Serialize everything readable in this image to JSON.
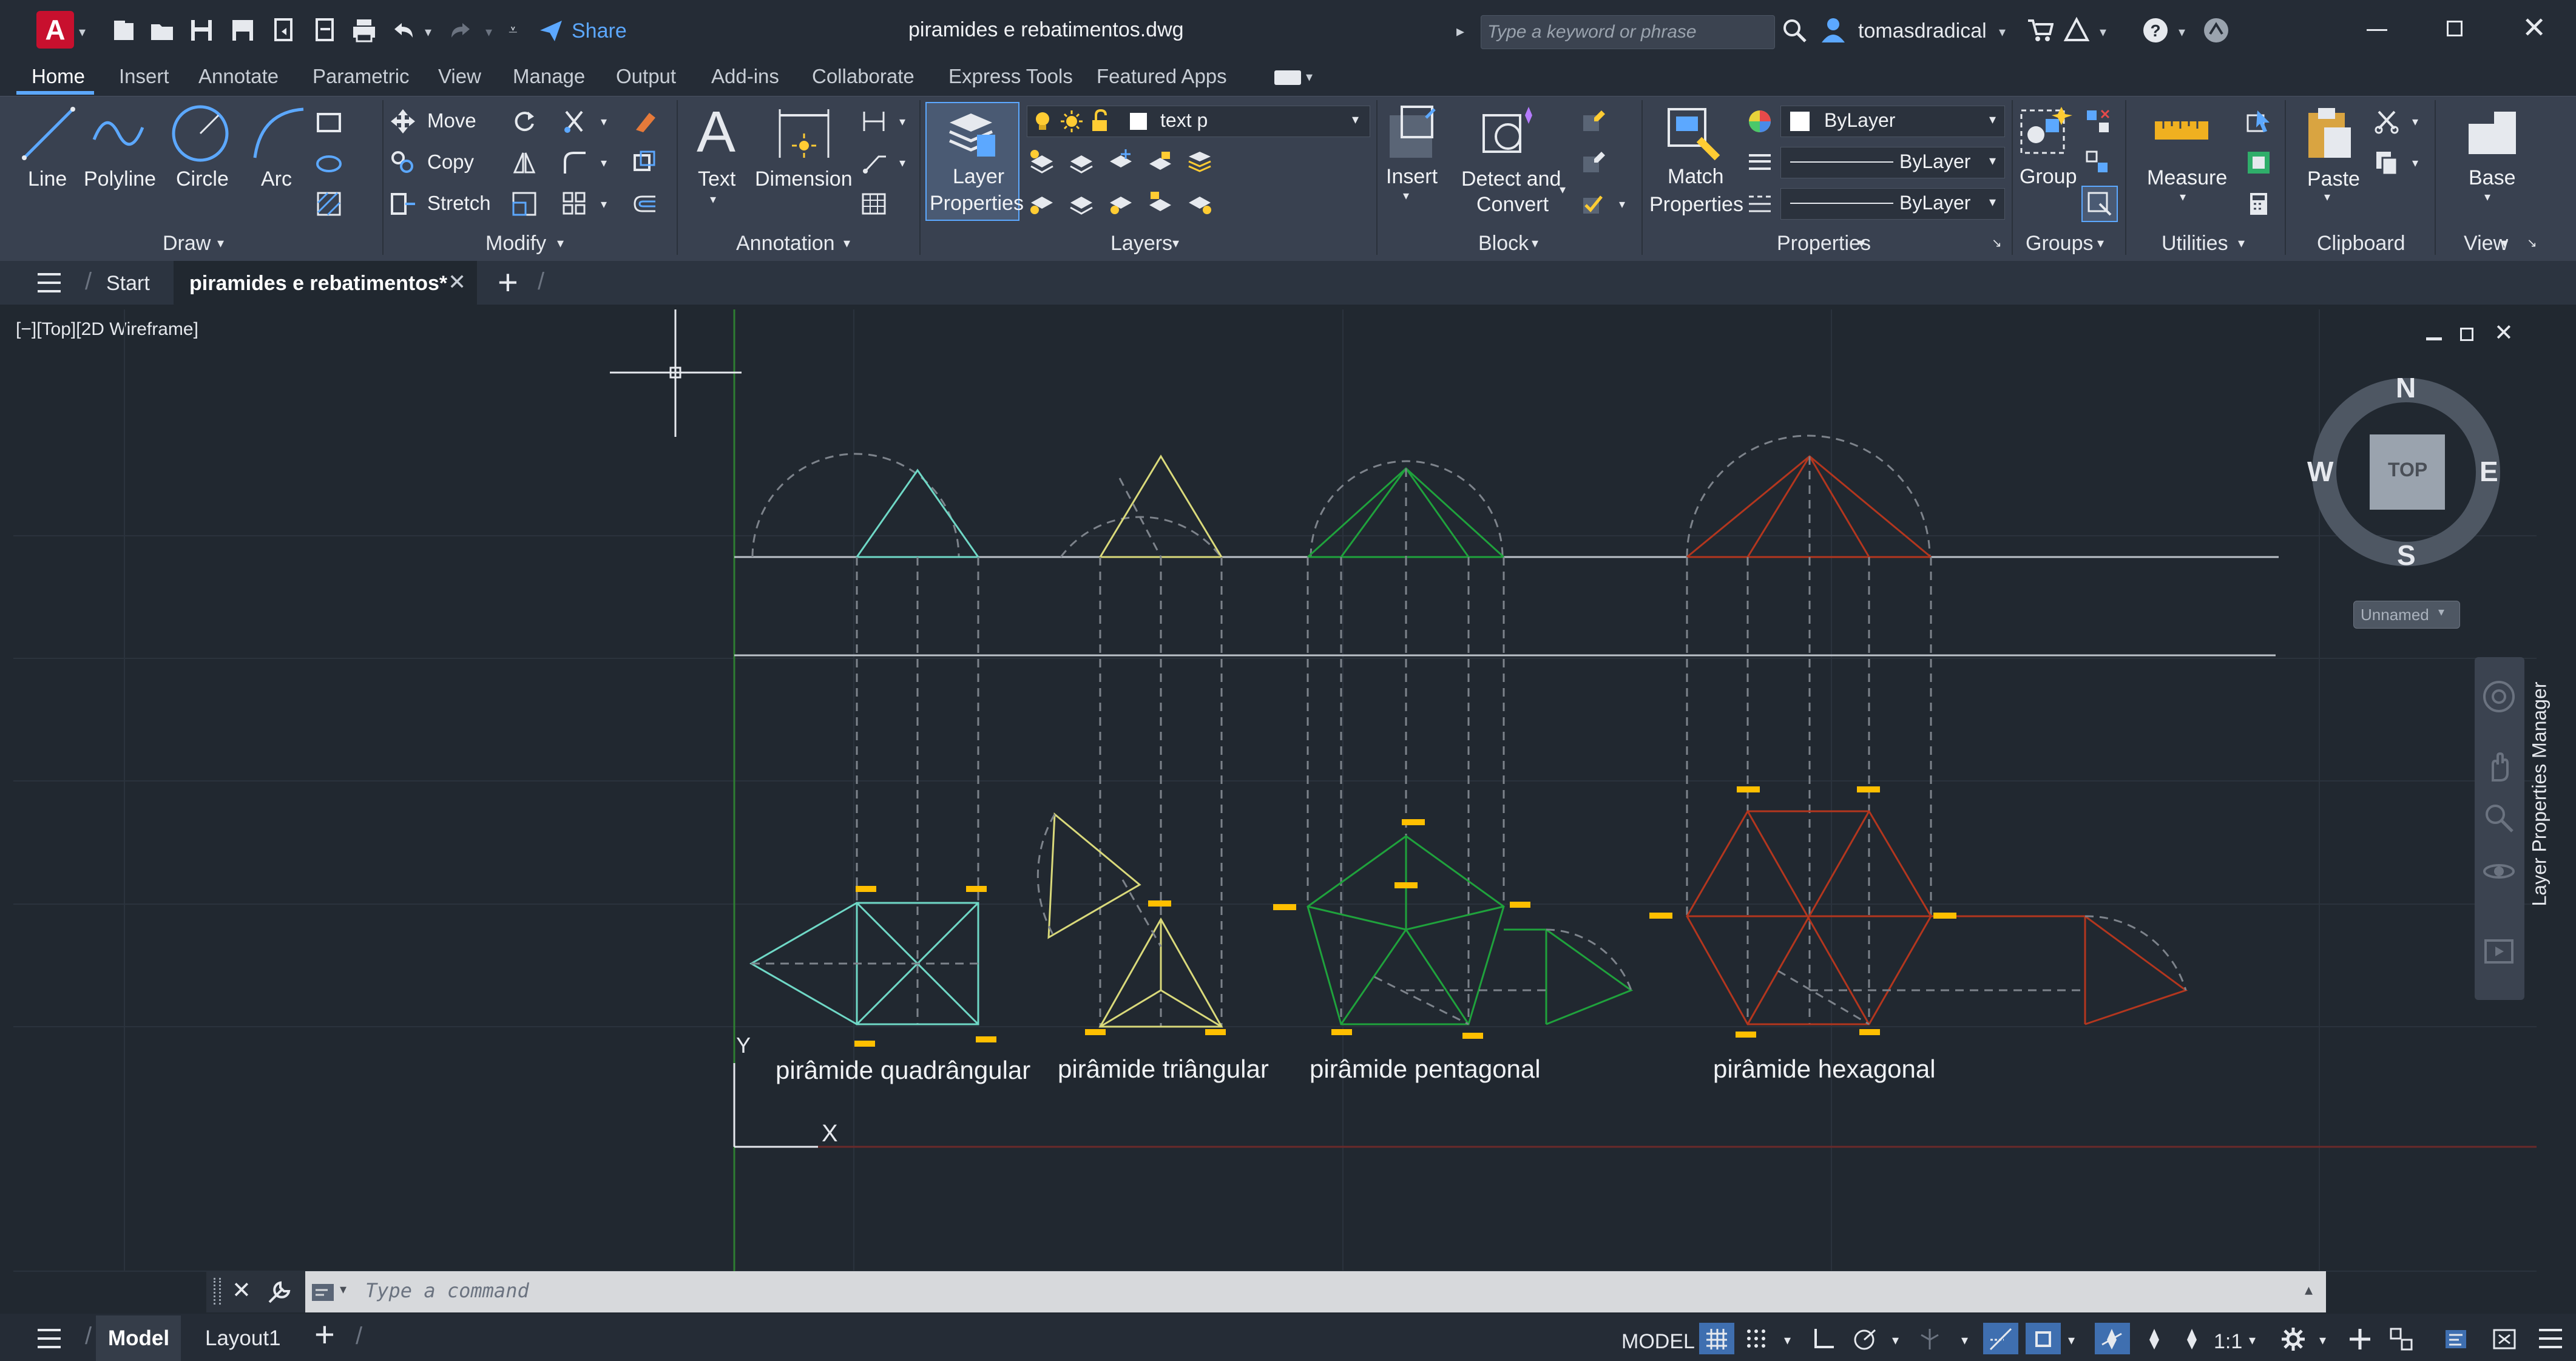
{
  "app": {
    "title": "piramides e rebatimentos.dwg",
    "share_label": "Share",
    "search_placeholder": "Type a keyword or phrase",
    "user_name": "tomasdradical",
    "logo_letter": "A"
  },
  "menu_tabs": [
    "Home",
    "Insert",
    "Annotate",
    "Parametric",
    "View",
    "Manage",
    "Output",
    "Add-ins",
    "Collaborate",
    "Express Tools",
    "Featured Apps"
  ],
  "ribbon": {
    "draw": {
      "label": "Draw",
      "line": "Line",
      "polyline": "Polyline",
      "circle": "Circle",
      "arc": "Arc"
    },
    "modify": {
      "label": "Modify",
      "move": "Move",
      "copy": "Copy",
      "stretch": "Stretch"
    },
    "annotation": {
      "label": "Annotation",
      "text": "Text",
      "dimension": "Dimension"
    },
    "layers": {
      "label": "Layers",
      "layer_properties_1": "Layer",
      "layer_properties_2": "Properties",
      "current_layer": "text p"
    },
    "block": {
      "label": "Block",
      "insert": "Insert",
      "detect_1": "Detect and",
      "detect_2": "Convert"
    },
    "properties": {
      "label": "Properties",
      "match_1": "Match",
      "match_2": "Properties",
      "color": "ByLayer",
      "linetype": "ByLayer",
      "lineweight": "ByLayer"
    },
    "groups": {
      "label": "Groups",
      "group": "Group"
    },
    "utilities": {
      "label": "Utilities",
      "measure": "Measure"
    },
    "clipboard": {
      "label": "Clipboard",
      "paste": "Paste"
    },
    "view": {
      "label": "View",
      "base": "Base"
    }
  },
  "file_tabs": {
    "start": "Start",
    "active": "piramides e rebatimentos*"
  },
  "viewport": {
    "label": "[−][Top][2D Wireframe]",
    "viewcube_top": "TOP",
    "compass_n": "N",
    "compass_s": "S",
    "compass_e": "E",
    "compass_w": "W",
    "ucs_name": "Unnamed",
    "ucs_y": "Y",
    "ucs_x": "X",
    "side_panel": "Layer Properties Manager"
  },
  "drawing_labels": {
    "quad": "pirâmide quadrângular",
    "tri": "pirâmide triângular",
    "pent": "pirâmide pentagonal",
    "hex": "pirâmide hexagonal"
  },
  "colors": {
    "cyan": "#6fd8c6",
    "yellow": "#d9d97a",
    "green": "#1fa23c",
    "red": "#b3361e",
    "grip": "#ffbf00",
    "accent": "#5ca8ff"
  },
  "command": {
    "placeholder": "Type a command"
  },
  "status": {
    "model_tab": "Model",
    "layout_tab": "Layout1",
    "model_indicator": "MODEL",
    "scale": "1:1"
  }
}
